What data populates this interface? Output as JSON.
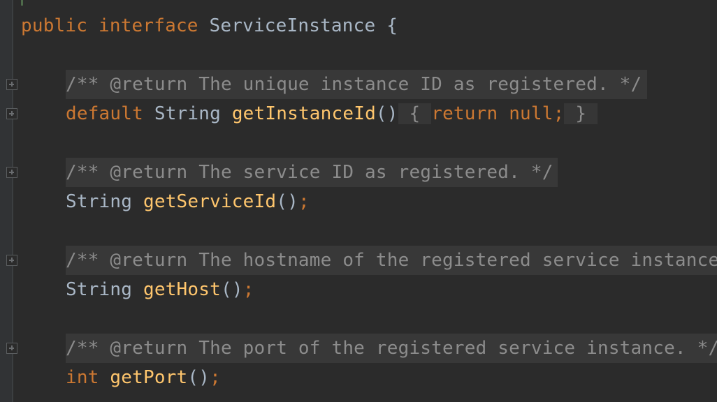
{
  "editor": {
    "language": "java",
    "line_interface": {
      "modifier": "public",
      "keyword": "interface",
      "name": "ServiceInstance",
      "brace": "{"
    },
    "members": [
      {
        "doc": "/** @return The unique instance ID as registered. */",
        "signature": {
          "modifier": "default",
          "return_type": "String",
          "method": "getInstanceId",
          "parens": "()",
          "body_open": "{",
          "body": "return null;",
          "body_close": "}"
        }
      },
      {
        "doc": "/** @return The service ID as registered. */",
        "signature": {
          "return_type": "String",
          "method": "getServiceId",
          "parens": "()",
          "semicolon": ";"
        }
      },
      {
        "doc": "/** @return The hostname of the registered service instance. */",
        "signature": {
          "return_type": "String",
          "method": "getHost",
          "parens": "()",
          "semicolon": ";"
        }
      },
      {
        "doc": "/** @return The port of the registered service instance. */",
        "signature": {
          "return_type": "int",
          "method": "getPort",
          "parens": "()",
          "semicolon": ";"
        }
      }
    ],
    "fold_icon": "plus-square-icon"
  },
  "colors": {
    "background": "#2b2b2b",
    "keyword": "#cc7832",
    "type": "#a9b7c6",
    "method": "#ffc66d",
    "comment": "#8c8c8c",
    "doc_background": "#383838"
  }
}
